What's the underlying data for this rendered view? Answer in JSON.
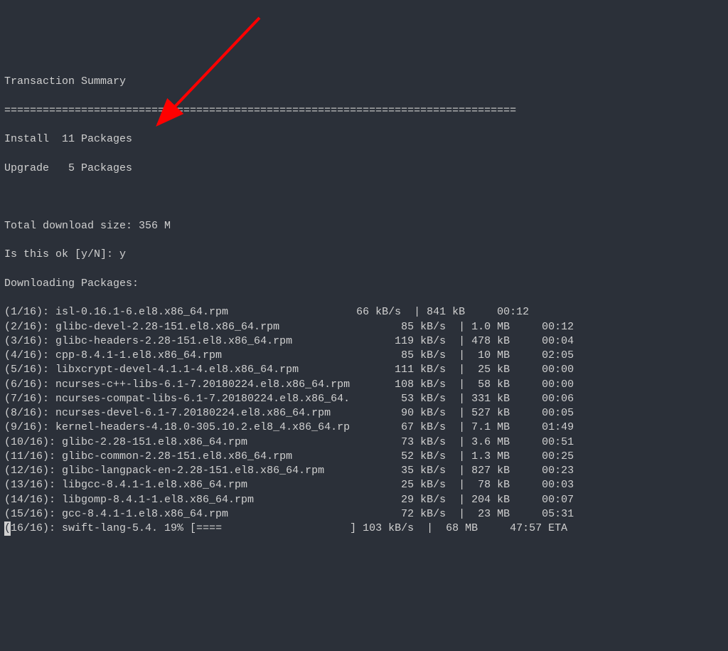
{
  "header": {
    "title": "Transaction Summary",
    "divider": "================================================================================",
    "install_label": "Install  11 Packages",
    "upgrade_label": "Upgrade   5 Packages",
    "total_size": "Total download size: 356 M",
    "confirm_prompt": "Is this ok [y/N]: y",
    "downloading_label": "Downloading Packages:"
  },
  "downloads": [
    {
      "idx": "(1/16): ",
      "name": "isl-0.16.1-6.el8.x86_64.rpm",
      "pad": 18,
      "speed": " 66 kB/s",
      "size": "| 841 kB",
      "time": "00:12",
      "eta": false
    },
    {
      "idx": "(2/16): ",
      "name": "glibc-devel-2.28-151.el8.x86_64.rpm",
      "pad": 17,
      "speed": " 85 kB/s",
      "size": "| 1.0 MB",
      "time": "00:12",
      "eta": false
    },
    {
      "idx": "(3/16): ",
      "name": "glibc-headers-2.28-151.el8.x86_64.rpm",
      "pad": 15,
      "speed": "119 kB/s",
      "size": "| 478 kB",
      "time": "00:04",
      "eta": false
    },
    {
      "idx": "(4/16): ",
      "name": "cpp-8.4.1-1.el8.x86_64.rpm",
      "pad": 26,
      "speed": " 85 kB/s",
      "size": "|  10 MB",
      "time": "02:05",
      "eta": false
    },
    {
      "idx": "(5/16): ",
      "name": "libxcrypt-devel-4.1.1-4.el8.x86_64.rpm",
      "pad": 14,
      "speed": "111 kB/s",
      "size": "|  25 kB",
      "time": "00:00",
      "eta": false
    },
    {
      "idx": "(6/16): ",
      "name": "ncurses-c++-libs-6.1-7.20180224.el8.x86_64.rpm",
      "pad": 6,
      "speed": "108 kB/s",
      "size": "|  58 kB",
      "time": "00:00",
      "eta": false
    },
    {
      "idx": "(7/16): ",
      "name": "ncurses-compat-libs-6.1-7.20180224.el8.x86_64.",
      "pad": 6,
      "speed": " 53 kB/s",
      "size": "| 331 kB",
      "time": "00:06",
      "eta": false
    },
    {
      "idx": "(8/16): ",
      "name": "ncurses-devel-6.1-7.20180224.el8.x86_64.rpm",
      "pad": 9,
      "speed": " 90 kB/s",
      "size": "| 527 kB",
      "time": "00:05",
      "eta": false
    },
    {
      "idx": "(9/16): ",
      "name": "kernel-headers-4.18.0-305.10.2.el8_4.x86_64.rp",
      "pad": 6,
      "speed": " 67 kB/s",
      "size": "| 7.1 MB",
      "time": "01:49",
      "eta": false
    },
    {
      "idx": "(10/16): ",
      "name": "glibc-2.28-151.el8.x86_64.rpm",
      "pad": 22,
      "speed": " 73 kB/s",
      "size": "| 3.6 MB",
      "time": "00:51",
      "eta": false
    },
    {
      "idx": "(11/16): ",
      "name": "glibc-common-2.28-151.el8.x86_64.rpm",
      "pad": 15,
      "speed": " 52 kB/s",
      "size": "| 1.3 MB",
      "time": "00:25",
      "eta": false
    },
    {
      "idx": "(12/16): ",
      "name": "glibc-langpack-en-2.28-151.el8.x86_64.rpm",
      "pad": 10,
      "speed": " 35 kB/s",
      "size": "| 827 kB",
      "time": "00:23",
      "eta": false
    },
    {
      "idx": "(13/16): ",
      "name": "libgcc-8.4.1-1.el8.x86_64.rpm",
      "pad": 22,
      "speed": " 25 kB/s",
      "size": "|  78 kB",
      "time": "00:03",
      "eta": false
    },
    {
      "idx": "(14/16): ",
      "name": "libgomp-8.4.1-1.el8.x86_64.rpm",
      "pad": 21,
      "speed": " 29 kB/s",
      "size": "| 204 kB",
      "time": "00:07",
      "eta": false
    },
    {
      "idx": "(15/16): ",
      "name": "gcc-8.4.1-1.el8.x86_64.rpm",
      "pad": 25,
      "speed": " 72 kB/s",
      "size": "|  23 MB",
      "time": "05:31",
      "eta": false
    },
    {
      "idx": "16/16): ",
      "name": "swift-lang-5.4. 19% [====                    ]",
      "pad": 0,
      "speed": "103 kB/s",
      "size": "|  68 MB",
      "time": "47:57",
      "eta": true
    }
  ],
  "eta_label": " ETA",
  "colors": {
    "bg": "#2b3039",
    "fg": "#d0d0d0",
    "arrow": "#ff0000"
  }
}
